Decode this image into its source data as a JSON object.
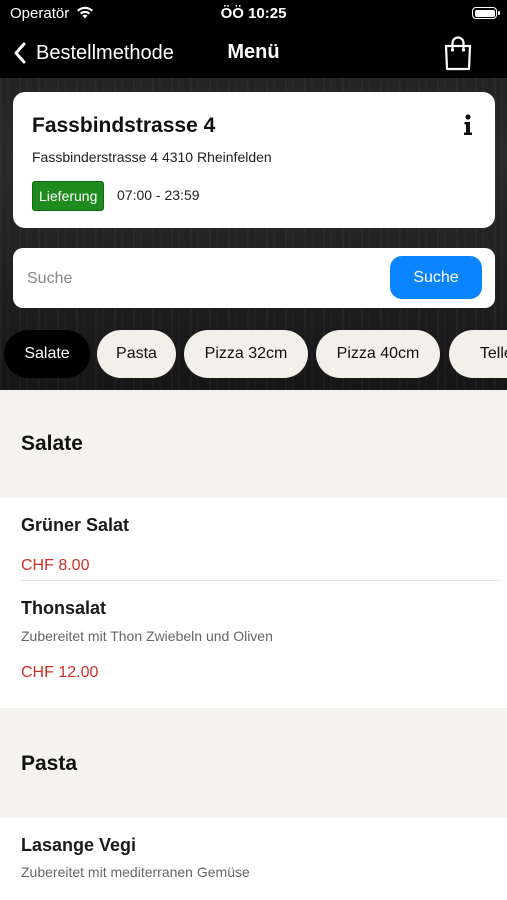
{
  "status_bar": {
    "carrier": "Operatör",
    "time": "ÖÖ 10:25"
  },
  "nav": {
    "back_label": "Bestellmethode",
    "title": "Menü"
  },
  "store": {
    "name": "Fassbindstrasse 4",
    "address": "Fassbinderstrasse 4 4310 Rheinfelden",
    "mode_badge": "Lieferung",
    "hours": "07:00 - 23:59",
    "badge_color": "#1f8b1f"
  },
  "search": {
    "placeholder": "Suche",
    "button_label": "Suche",
    "button_color": "#0a84ff"
  },
  "categories": [
    "Salate",
    "Pasta",
    "Pizza 32cm",
    "Pizza 40cm",
    "Teller"
  ],
  "active_category": "Salate",
  "sections": [
    {
      "title": "Salate",
      "items": [
        {
          "name": "Grüner Salat",
          "description": "",
          "price": "CHF 8.00"
        },
        {
          "name": "Thonsalat",
          "description": "Zubereitet mit Thon Zwiebeln und Oliven",
          "price": "CHF 12.00"
        }
      ]
    },
    {
      "title": "Pasta",
      "items": [
        {
          "name": "Lasange Vegi",
          "description": "Zubereitet mit mediterranen Gemüse",
          "price": ""
        }
      ]
    }
  ],
  "colors": {
    "price": "#d0302a",
    "section_bg": "#f5f3f0",
    "chip_bg": "#f3efe9"
  }
}
